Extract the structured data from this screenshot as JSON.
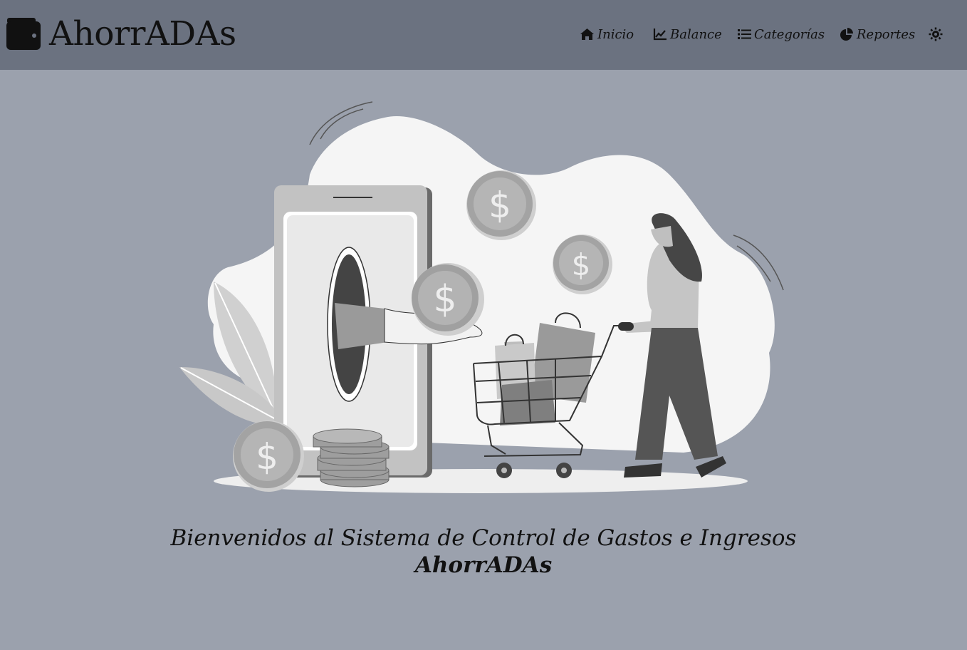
{
  "brand": {
    "name": "AhorrADAs",
    "icon": "wallet-icon"
  },
  "nav": {
    "items": [
      {
        "label": "Inicio",
        "icon": "home-icon"
      },
      {
        "label": "Balance",
        "icon": "chart-line-icon"
      },
      {
        "label": "Categorías",
        "icon": "list-icon"
      },
      {
        "label": "Reportes",
        "icon": "pie-chart-icon"
      }
    ],
    "theme_toggle_icon": "sun-icon"
  },
  "welcome": {
    "line": "Bienvenidos al Sistema de Control de Gastos e Ingresos",
    "title": "AhorrADAs"
  },
  "colors": {
    "navbar": "#6b7280",
    "background": "#9ba1ad",
    "text": "#111111",
    "illustration_light": "#f5f5f5"
  }
}
